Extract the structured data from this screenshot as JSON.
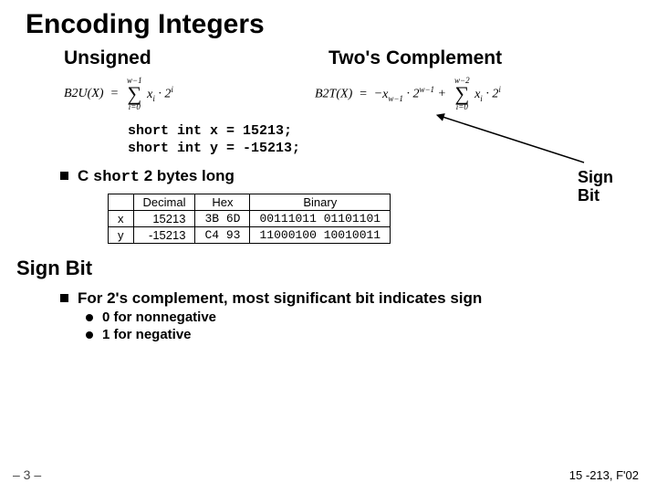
{
  "title": "Encoding Integers",
  "subheads": {
    "unsigned": "Unsigned",
    "twos": "Two's Complement"
  },
  "formula": {
    "b2u": "B2U(X)",
    "b2t": "B2T(X)",
    "eq": " = ",
    "sum_top_w1": "w−1",
    "sum_top_w2": "w−2",
    "sum_bot": "i=0",
    "term_xi2i": "x_i · 2^i",
    "term_neg": "−x_{w−1} · 2^{w−1}",
    "plus": " + "
  },
  "code": {
    "line1": "short int x =  15213;",
    "line2": "short int y = -15213;"
  },
  "bullet_main": {
    "pre": "C ",
    "mono": "short",
    "post": " 2 bytes long"
  },
  "table": {
    "headers": [
      "",
      "Decimal",
      "Hex",
      "Binary"
    ],
    "rows": [
      {
        "lbl": "x",
        "dec": "15213",
        "hex": "3B 6D",
        "bin": "00111011 01101101"
      },
      {
        "lbl": "y",
        "dec": "-15213",
        "hex": "C4 93",
        "bin": "11000100 10010011"
      }
    ]
  },
  "section2": "Sign Bit",
  "bullet2": "For 2's complement, most significant bit indicates sign",
  "sub_bullets": [
    "0 for nonnegative",
    "1 for negative"
  ],
  "signbit_label": {
    "l1": "Sign",
    "l2": "Bit"
  },
  "footer": {
    "left": "– 3 –",
    "right": "15 -213, F'02"
  }
}
